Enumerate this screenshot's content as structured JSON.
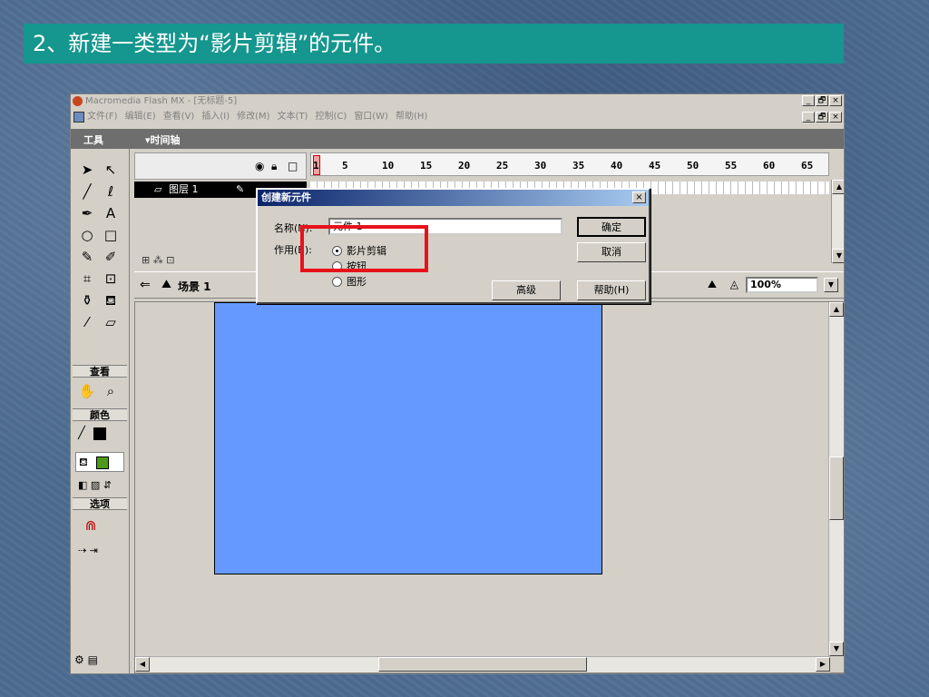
{
  "slide": {
    "title": "2、新建一类型为“影片剪辑”的元件。"
  },
  "window": {
    "title": "Macromedia Flash MX - [无标题-5]",
    "controls": [
      "_",
      "🗗",
      "×"
    ]
  },
  "menu": {
    "items": [
      "文件(F)",
      "编辑(E)",
      "查看(V)",
      "插入(I)",
      "修改(M)",
      "文本(T)",
      "控制(C)",
      "窗口(W)",
      "帮助(H)"
    ]
  },
  "panels": {
    "tools_title": "工具",
    "timeline_title": "▾时间轴"
  },
  "tools": {
    "view_section": "查看",
    "color_section": "颜色",
    "options_section": "选项",
    "stroke_color": "#000000",
    "fill_color": "#4c9a1a"
  },
  "timeline": {
    "frame_numbers": [
      "1",
      "5",
      "10",
      "15",
      "20",
      "25",
      "30",
      "35",
      "40",
      "45",
      "50",
      "55",
      "60",
      "65"
    ],
    "layer_name": "图层 1"
  },
  "edit_bar": {
    "scene": "场景 1",
    "zoom": "100%"
  },
  "stage": {
    "color": "#6699ff"
  },
  "dialog": {
    "title": "创建新元件",
    "name_label": "名称(N):",
    "name_value": "元件 1",
    "behavior_label": "作用(B):",
    "options": [
      {
        "label": "影片剪辑",
        "selected": true
      },
      {
        "label": "按钮",
        "selected": false
      },
      {
        "label": "图形",
        "selected": false
      }
    ],
    "ok": "确定",
    "cancel": "取消",
    "advanced": "高级",
    "help": "帮助(H)"
  },
  "highlight_color": "#e8121a"
}
